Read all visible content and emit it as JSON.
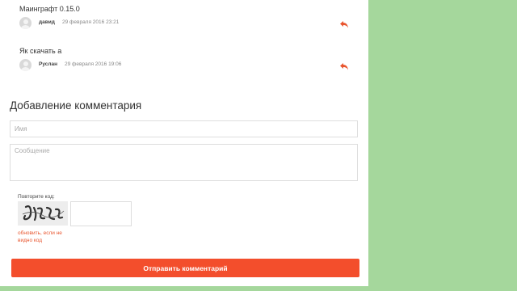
{
  "comments": [
    {
      "text": "Маинграфт 0.15.0",
      "author": "давид",
      "date": "29 февраля 2016 23:21",
      "reply_icon": "reply-arrow-icon"
    },
    {
      "text": "Як скачать а",
      "author": "Руслан",
      "date": "29 февраля 2016 19:06",
      "reply_icon": "reply-arrow-icon"
    }
  ],
  "form": {
    "title": "Добавление комментария",
    "name_placeholder": "Имя",
    "name_value": "",
    "message_placeholder": "Сообщение",
    "message_value": "",
    "captcha_label": "Повторите код:",
    "captcha_value": "",
    "captcha_refresh": "обновить, если не видно код",
    "submit_label": "Отправить комментарий"
  },
  "colors": {
    "background": "#a5d79c",
    "panel": "#ffffff",
    "accent": "#f34e2c",
    "link": "#e8552e"
  }
}
